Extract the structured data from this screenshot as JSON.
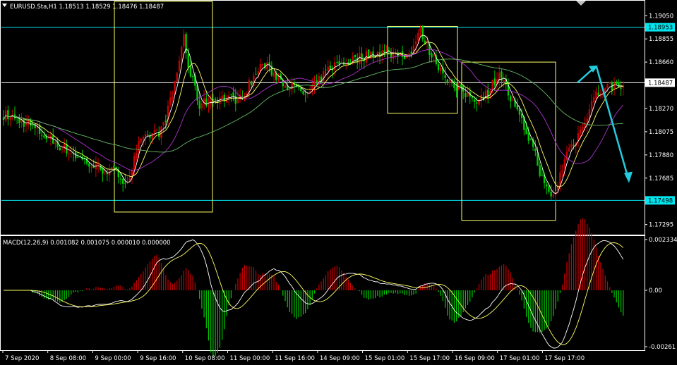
{
  "window": {
    "symbol_title": "EURUSD.Sta,H1",
    "ohlc": "1.18513 1.18529 1.18476 1.18487",
    "header_text": "EURUSD.Sta,H1  1.18513 1.18529 1.18476 1.18487"
  },
  "macd": {
    "header_text": "MACD(12,26,9) 0.001082 0.001075 0.000010 0.000000",
    "axis_labels": [
      "0.002334",
      "0.00",
      "-0.00261"
    ]
  },
  "price_axis": {
    "labels": [
      "1.19050",
      "1.18855",
      "1.18660",
      "1.18270",
      "1.18075",
      "1.17880",
      "1.17685",
      "1.17295"
    ],
    "level_boxes": [
      {
        "value": "1.18953",
        "color": "#00e5ee"
      },
      {
        "value": "1.18487",
        "color": "#ffffff"
      },
      {
        "value": "1.17498",
        "color": "#00e5ee"
      }
    ]
  },
  "time_axis": {
    "labels": [
      "7 Sep 2020",
      "8 Sep 08:00",
      "9 Sep 00:00",
      "9 Sep 16:00",
      "10 Sep 08:00",
      "11 Sep 00:00",
      "11 Sep 16:00",
      "14 Sep 09:00",
      "15 Sep 01:00",
      "15 Sep 17:00",
      "16 Sep 09:00",
      "17 Sep 01:00",
      "17 Sep 17:00"
    ]
  },
  "colors": {
    "background": "#000000",
    "bull_candle": "#cc0000",
    "bear_candle": "#00cc00",
    "ma_fast": "#ffffff",
    "ma_mid": "#ffff66",
    "ma_slow": "#aa33cc",
    "ma_long": "#66bb66",
    "level_line": "#00e5ee",
    "box": "#ffff66",
    "arrow": "#22ccdd"
  },
  "chart_data": [
    {
      "type": "candlestick",
      "title": "EURUSD.Sta,H1",
      "ylim": [
        1.1721,
        1.1917
      ],
      "x_ticks": [
        "7 Sep 2020",
        "8 Sep 08:00",
        "9 Sep 00:00",
        "9 Sep 16:00",
        "10 Sep 08:00",
        "11 Sep 00:00",
        "11 Sep 16:00",
        "14 Sep 09:00",
        "15 Sep 01:00",
        "15 Sep 17:00",
        "16 Sep 09:00",
        "17 Sep 01:00",
        "17 Sep 17:00"
      ],
      "y_ticks": [
        1.1905,
        1.18855,
        1.1866,
        1.1827,
        1.18075,
        1.1788,
        1.17685,
        1.17295
      ],
      "horizontal_levels": [
        1.18953,
        1.18487,
        1.17498
      ],
      "close_path": [
        [
          0,
          1.1822
        ],
        [
          10,
          1.1815
        ],
        [
          20,
          1.1802
        ],
        [
          30,
          1.179
        ],
        [
          40,
          1.1778
        ],
        [
          50,
          1.1773
        ],
        [
          55,
          1.1765
        ],
        [
          60,
          1.1796
        ],
        [
          65,
          1.1805
        ],
        [
          70,
          1.1808
        ],
        [
          75,
          1.1838
        ],
        [
          80,
          1.1888
        ],
        [
          82,
          1.1862
        ],
        [
          87,
          1.183
        ],
        [
          95,
          1.1836
        ],
        [
          105,
          1.1835
        ],
        [
          115,
          1.1865
        ],
        [
          125,
          1.1848
        ],
        [
          135,
          1.1838
        ],
        [
          145,
          1.1862
        ],
        [
          155,
          1.1868
        ],
        [
          165,
          1.1874
        ],
        [
          175,
          1.1873
        ],
        [
          180,
          1.1872
        ],
        [
          185,
          1.1892
        ],
        [
          190,
          1.1872
        ],
        [
          200,
          1.1844
        ],
        [
          210,
          1.1835
        ],
        [
          215,
          1.184
        ],
        [
          220,
          1.1858
        ],
        [
          225,
          1.1835
        ],
        [
          230,
          1.1815
        ],
        [
          235,
          1.1795
        ],
        [
          240,
          1.1761
        ],
        [
          244,
          1.1752
        ],
        [
          250,
          1.179
        ],
        [
          256,
          1.1808
        ],
        [
          262,
          1.1837
        ],
        [
          268,
          1.1845
        ],
        [
          275,
          1.1848
        ]
      ],
      "projection": {
        "from": 1.18487,
        "up_to": 1.1862,
        "down_to": 1.1768
      }
    },
    {
      "type": "histogram",
      "title": "MACD(12,26,9)",
      "values_text": "0.001082 0.001075 0.000010 0.000000",
      "ylim": [
        -0.00261,
        0.002334
      ]
    }
  ]
}
